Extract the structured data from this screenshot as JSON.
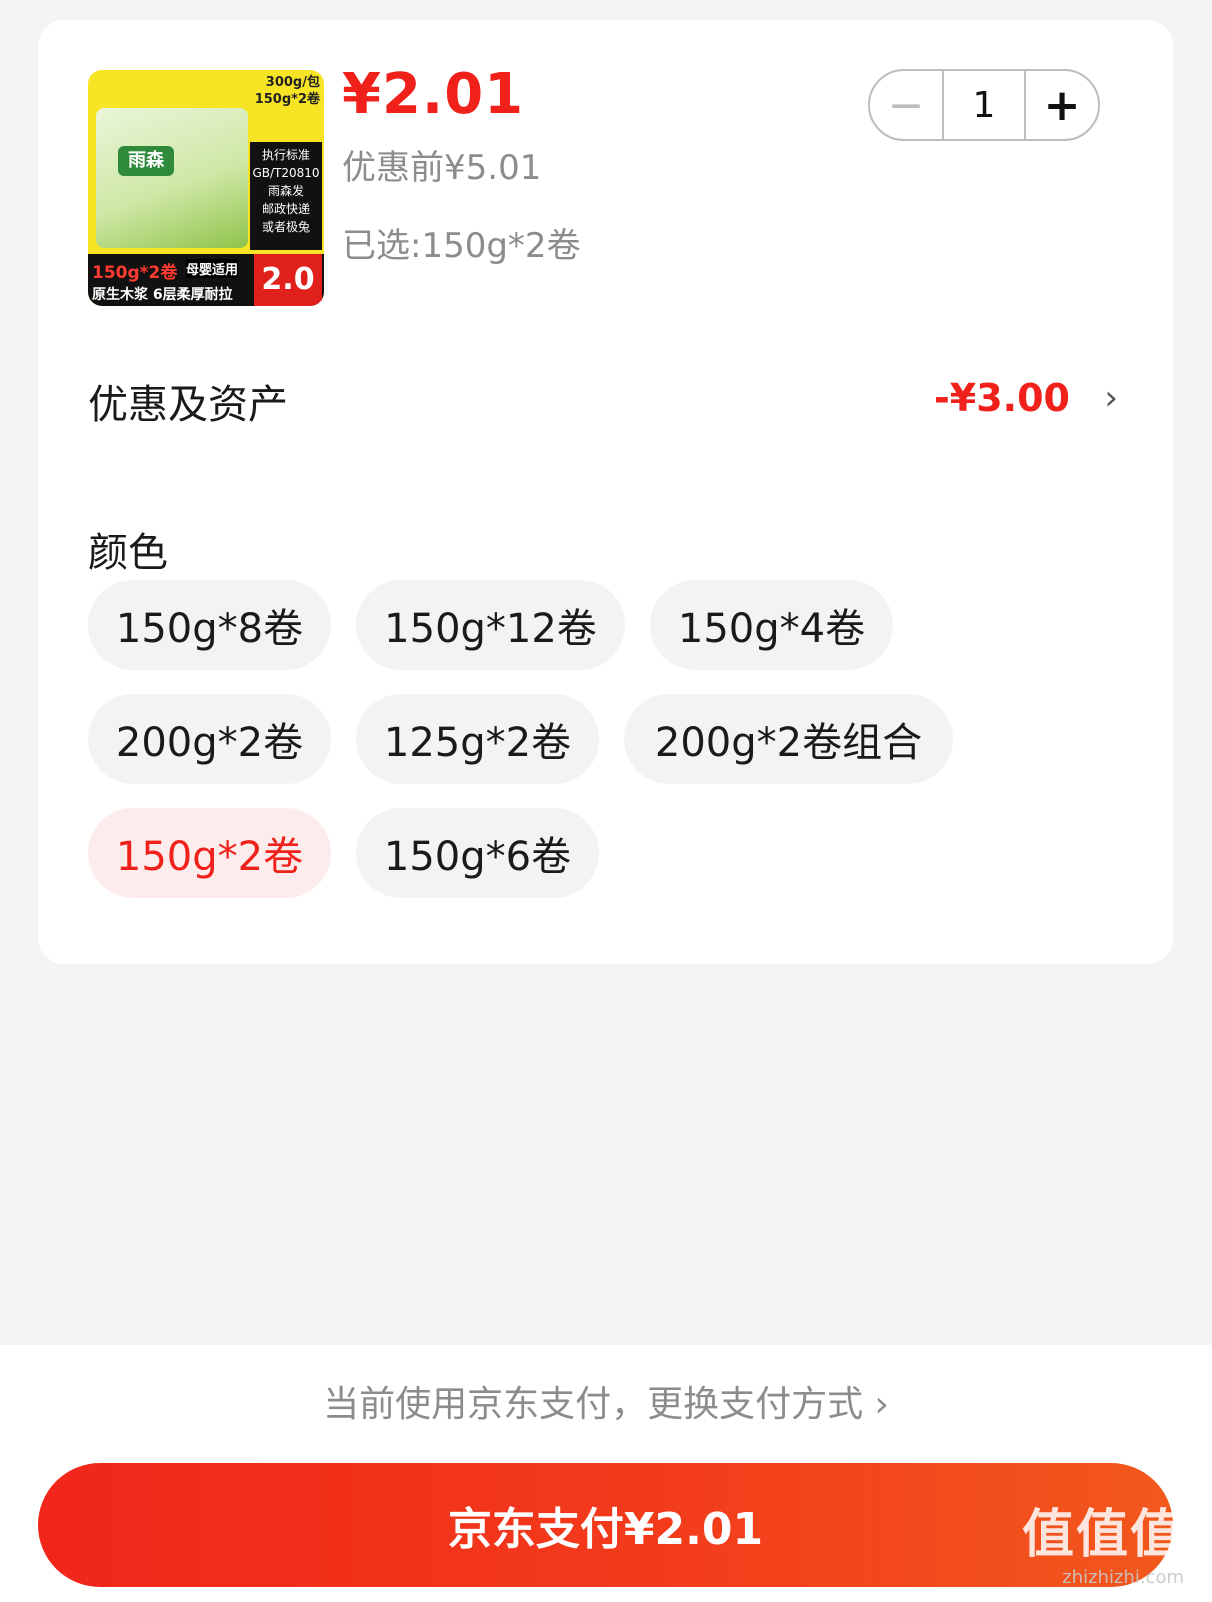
{
  "product": {
    "image_text": {
      "top": "300g/包\n150g*2卷",
      "brand": "雨森",
      "side": "执行标准\nGB/T20810\n雨森发\n邮政快递\n或者极兔",
      "bottom_left": "150g*2卷",
      "bottom_mid": "母婴适用",
      "bottom_line": "原生木浆 6层柔厚耐拉",
      "bottom_price": "2.0"
    },
    "price": "¥2.01",
    "original_price": "优惠前¥5.01",
    "selected": "已选:150g*2卷"
  },
  "stepper": {
    "minus": "−",
    "quantity": "1",
    "plus": "+"
  },
  "benefits": {
    "label": "优惠及资产",
    "value": "-¥3.00",
    "chevron": "›"
  },
  "color_section": {
    "title": "颜色",
    "options": [
      "150g*8卷",
      "150g*12卷",
      "150g*4卷",
      "200g*2卷",
      "125g*2卷",
      "200g*2卷组合",
      "150g*2卷",
      "150g*6卷"
    ],
    "selected_index": 6
  },
  "payment": {
    "note": "当前使用京东支付，更换支付方式 ›",
    "button": "京东支付¥2.01"
  },
  "watermark": {
    "line1": "值值值",
    "line2": "zhizhizhi.com"
  },
  "colors": {
    "accent": "#f0201a",
    "selected_bg": "#fdecec",
    "chip_bg": "#f3f3f3"
  }
}
